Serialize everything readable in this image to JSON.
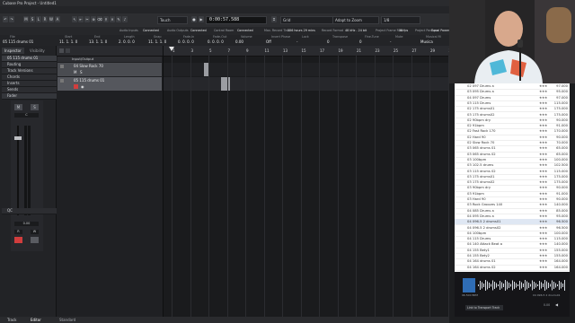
{
  "window": {
    "title": "Cubase Pro Project - Untitled1"
  },
  "menu": [
    "File",
    "Edit",
    "Project",
    "Audio",
    "MIDI",
    "Score",
    "Media",
    "Transport",
    "Studio",
    "Workspaces",
    "Window",
    "VST Cloud",
    "Hub",
    "Help"
  ],
  "toolbar": {
    "automation_mode": "Touch",
    "time_display": "0:00:57.588",
    "snap_type": "Grid",
    "snap_mode": "Adapt to Zoom",
    "quantize": "1/8",
    "buttons": [
      "M",
      "S",
      "L",
      "R",
      "W",
      "A"
    ]
  },
  "status": [
    {
      "label": "Audio Inputs",
      "value": "Connected"
    },
    {
      "label": "Audio Outputs",
      "value": "Connected"
    },
    {
      "label": "Control Room",
      "value": "Connected"
    },
    {
      "label": "Max. Record Time",
      "value": "226 hours 29 mins"
    },
    {
      "label": "Record Format",
      "value": "48 kHz - 24 bit"
    },
    {
      "label": "Project Frame Rate",
      "value": "30 fps"
    },
    {
      "label": "Project Pan Law",
      "value": "Equal Power"
    }
  ],
  "infoline": {
    "file": {
      "label": "File",
      "value": "05 115 drums 01"
    },
    "start": {
      "label": "Start",
      "value": "11. 1. 1. 0"
    },
    "end": {
      "label": "End",
      "value": "13. 1. 1. 0"
    },
    "length": {
      "label": "Length",
      "value": "2. 0. 0. 0"
    },
    "snap": {
      "label": "Snap",
      "value": "11. 1. 1. 0"
    },
    "fadein": {
      "label": "Fade-In",
      "value": "0. 0. 0. 0"
    },
    "fadeout": {
      "label": "Fade-Out",
      "value": "0. 0. 0. 0"
    },
    "volume": {
      "label": "Volume",
      "value": "0.00"
    },
    "invert": {
      "label": "Invert Phase",
      "value": "Off"
    },
    "lock": {
      "label": "Lock",
      "value": "-"
    },
    "transpose": {
      "label": "Transpose",
      "value": "0"
    },
    "finetune": {
      "label": "Fine-Tune",
      "value": "0"
    },
    "mute": {
      "label": "Mute",
      "value": "-"
    },
    "musical": {
      "label": "Musical M",
      "value": "Musica"
    }
  },
  "inspector": {
    "tabs": [
      "Inspector",
      "Visibility"
    ],
    "track_name": "05 115 drums 01",
    "sections": [
      "Routing",
      "Track Versions",
      "Chords",
      "Inserts",
      "Sends",
      "Fader"
    ],
    "sections_bottom": [
      "QC"
    ],
    "fader_value": "0.00",
    "pan_value": "C"
  },
  "tracklist": {
    "header": "Input/Output",
    "tracks": [
      {
        "name": "04 Slow Rock 70"
      },
      {
        "name": "05 115 drums 01"
      }
    ]
  },
  "ruler": [
    "1",
    "3",
    "5",
    "7",
    "9",
    "11",
    "13",
    "15",
    "17",
    "19",
    "21",
    "23",
    "25",
    "27",
    "29",
    "31"
  ],
  "bottom": {
    "tabs": [
      "Track",
      "Editor"
    ],
    "status_left": "Standard"
  },
  "browser": {
    "colors": {
      "accent": "#2f6db5"
    },
    "rows": [
      {
        "name": "02 097 Drums a",
        "stars": "★★★",
        "tempo": "97.000"
      },
      {
        "name": "03 095 Drums a",
        "stars": "★★★",
        "tempo": "95.000"
      },
      {
        "name": "04 097 Drums",
        "stars": "★★★",
        "tempo": "97.000"
      },
      {
        "name": "03 115 Drums",
        "stars": "★★★",
        "tempo": "115.000"
      },
      {
        "name": "02 175 drums01",
        "stars": "★★★",
        "tempo": "175.000"
      },
      {
        "name": "03 175 drums02",
        "stars": "★★★",
        "tempo": "175.000"
      },
      {
        "name": "02 90bpm dry",
        "stars": "★★★",
        "tempo": "90.000"
      },
      {
        "name": "02 91bpm",
        "stars": "★★★",
        "tempo": "91.000"
      },
      {
        "name": "02 Fast Rock 170",
        "stars": "★★★",
        "tempo": "170.000"
      },
      {
        "name": "02 Hard 90",
        "stars": "★★★",
        "tempo": "90.000"
      },
      {
        "name": "02 Slow Rock 70",
        "stars": "★★★",
        "tempo": "70.000"
      },
      {
        "name": "03 065 drums 01",
        "stars": "★★★",
        "tempo": "65.000"
      },
      {
        "name": "03 065 drums 02",
        "stars": "★★★",
        "tempo": "65.000"
      },
      {
        "name": "03 100bpm",
        "stars": "★★★",
        "tempo": "100.000"
      },
      {
        "name": "03 102.5 drums",
        "stars": "★★★",
        "tempo": "102.500"
      },
      {
        "name": "03 115 drums 02",
        "stars": "★★★",
        "tempo": "115.000"
      },
      {
        "name": "03 175 drums01",
        "stars": "★★★",
        "tempo": "175.000"
      },
      {
        "name": "03 175 drums02",
        "stars": "★★★",
        "tempo": "175.000"
      },
      {
        "name": "03 90bpm dry",
        "stars": "★★★",
        "tempo": "90.000"
      },
      {
        "name": "03 91bpm",
        "stars": "★★★",
        "tempo": "91.000"
      },
      {
        "name": "03 Hard 90",
        "stars": "★★★",
        "tempo": "90.000"
      },
      {
        "name": "03 Rock Grooves 140",
        "stars": "★★★",
        "tempo": "140.000"
      },
      {
        "name": "04 085 Drums a",
        "stars": "★★★",
        "tempo": "85.000"
      },
      {
        "name": "04 095 Drums a",
        "stars": "★★★",
        "tempo": "95.000"
      },
      {
        "name": "04 096.5 2 drums01",
        "stars": "★★★",
        "tempo": "96.500",
        "selected": true
      },
      {
        "name": "04 096.5 2 drums02",
        "stars": "★★★",
        "tempo": "96.500"
      },
      {
        "name": "04 100bpm",
        "stars": "★★★",
        "tempo": "100.000"
      },
      {
        "name": "04 115 Drums",
        "stars": "★★★",
        "tempo": "115.000"
      },
      {
        "name": "04 140 Attack Beat a",
        "stars": "★★★",
        "tempo": "140.000"
      },
      {
        "name": "04 155 Bety1",
        "stars": "★★★",
        "tempo": "155.000"
      },
      {
        "name": "04 155 Bety2",
        "stars": "★★★",
        "tempo": "155.000"
      },
      {
        "name": "04 164 drums 01",
        "stars": "★★★",
        "tempo": "164.000"
      },
      {
        "name": "04 164 drums 02",
        "stars": "★★★",
        "tempo": "164.000"
      }
    ]
  },
  "player": {
    "title": "04 096.5 2 drums01",
    "meta": "96.500 BPM",
    "link_label": "Link to Transport Track",
    "position": "0.00"
  }
}
